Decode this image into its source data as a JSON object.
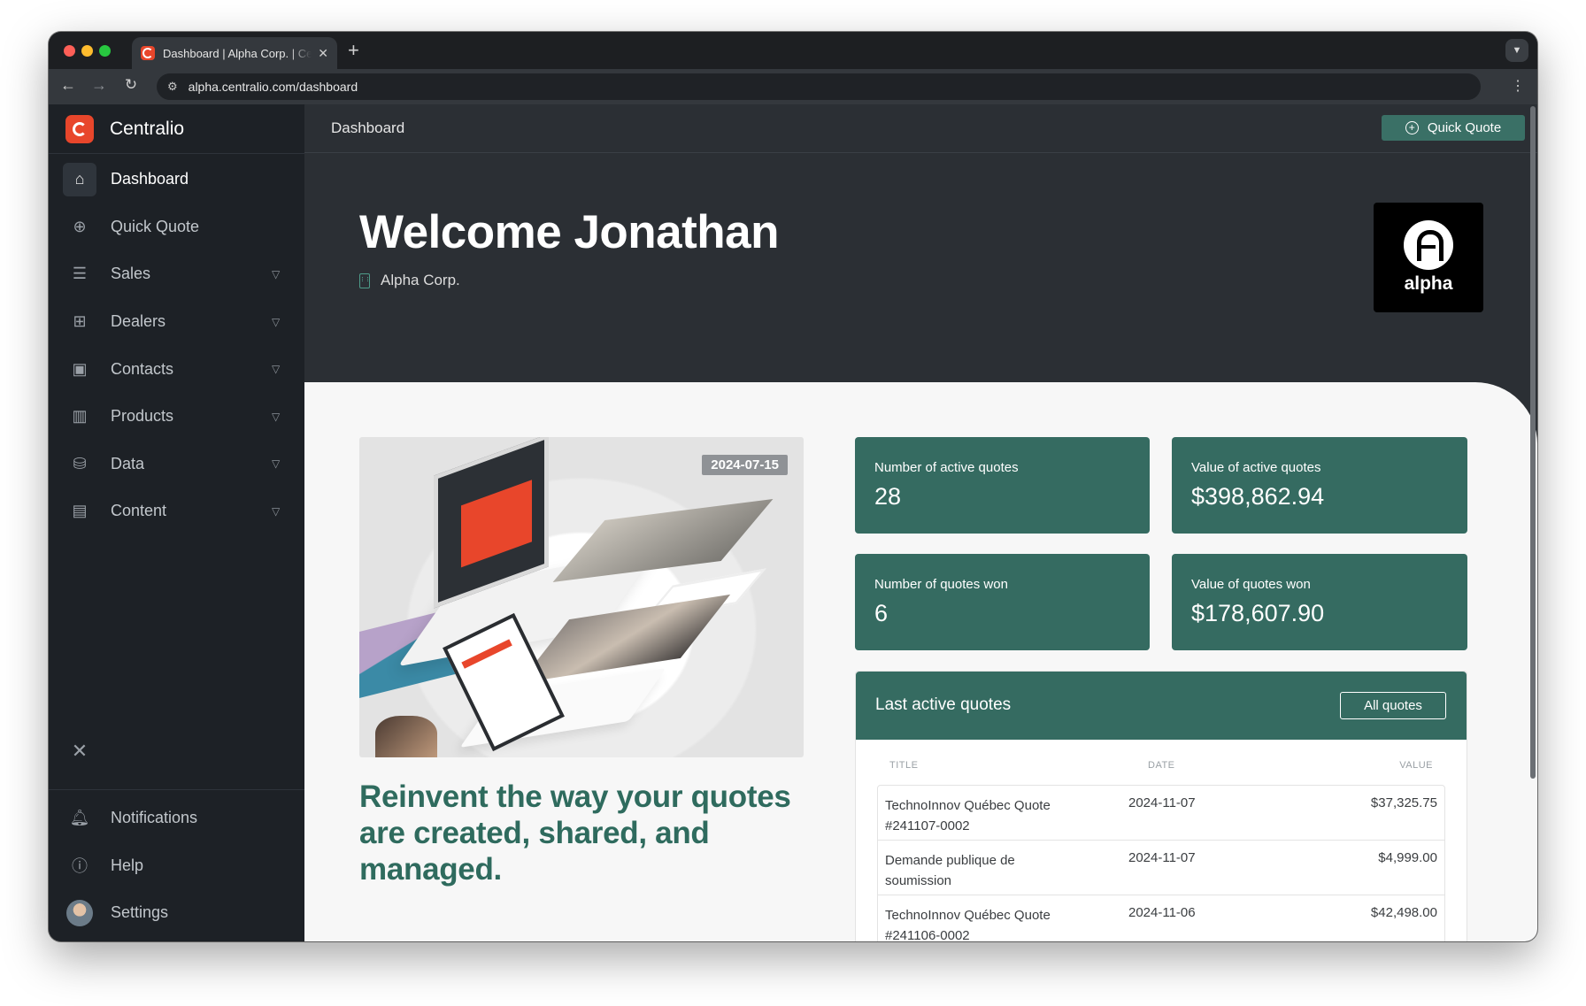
{
  "browser": {
    "tab_title": "Dashboard | Alpha Corp. | Centralio",
    "new_tab": "+",
    "close": "✕",
    "url": "alpha.centralio.com/dashboard"
  },
  "brand": {
    "name": "Centralio"
  },
  "sidebar": {
    "items": [
      {
        "label": "Dashboard",
        "icon": "home-icon",
        "active": true
      },
      {
        "label": "Quick Quote",
        "icon": "plus-circle-icon"
      },
      {
        "label": "Sales",
        "icon": "list-icon",
        "expandable": true
      },
      {
        "label": "Dealers",
        "icon": "network-icon",
        "expandable": true
      },
      {
        "label": "Contacts",
        "icon": "contact-icon",
        "expandable": true
      },
      {
        "label": "Products",
        "icon": "barcode-icon",
        "expandable": true
      },
      {
        "label": "Data",
        "icon": "database-icon",
        "expandable": true
      },
      {
        "label": "Content",
        "icon": "newspaper-icon",
        "expandable": true
      }
    ],
    "bottom": [
      {
        "label": "Notifications",
        "icon": "bell-icon"
      },
      {
        "label": "Help",
        "icon": "help-icon"
      },
      {
        "label": "Settings",
        "icon": "avatar"
      }
    ]
  },
  "header": {
    "title": "Dashboard",
    "quick_quote_label": "Quick Quote"
  },
  "hero": {
    "welcome": "Welcome Jonathan",
    "company": "Alpha Corp.",
    "logo_text": "alpha"
  },
  "promo": {
    "date": "2024-07-15",
    "tagline": "Reinvent the way your quotes are created, shared, and managed."
  },
  "stats": [
    {
      "label": "Number of active quotes",
      "value": "28"
    },
    {
      "label": "Value of active quotes",
      "value": "$398,862.94"
    },
    {
      "label": "Number of quotes won",
      "value": "6"
    },
    {
      "label": "Value of quotes won",
      "value": "$178,607.90"
    }
  ],
  "quotes": {
    "title": "Last active quotes",
    "all_label": "All quotes",
    "columns": {
      "title": "TITLE",
      "date": "DATE",
      "value": "VALUE"
    },
    "rows": [
      {
        "title": "TechnoInnov Québec Quote #241107-0002",
        "date": "2024-11-07",
        "value": "$37,325.75"
      },
      {
        "title": "Demande publique de soumission",
        "date": "2024-11-07",
        "value": "$4,999.00"
      },
      {
        "title": "TechnoInnov Québec Quote #241106-0002",
        "date": "2024-11-06",
        "value": "$42,498.00"
      }
    ]
  },
  "colors": {
    "accent": "#356b61",
    "brand": "#e8462b",
    "sidebar": "#1d2126",
    "header": "#2b2f34"
  }
}
